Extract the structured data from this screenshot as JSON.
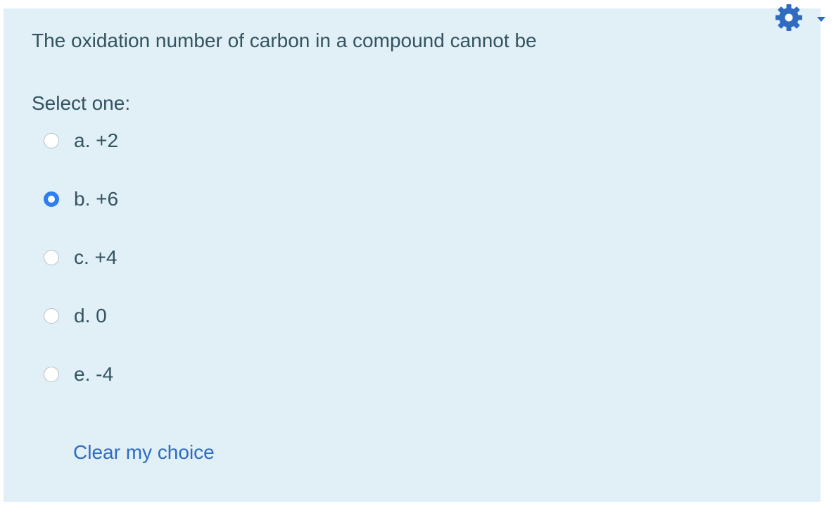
{
  "question": {
    "text": "The oxidation number of carbon in a compound cannot be",
    "prompt": "Select one:",
    "options": [
      {
        "label": "a. +2",
        "selected": false
      },
      {
        "label": "b. +6",
        "selected": true
      },
      {
        "label": "c. +4",
        "selected": false
      },
      {
        "label": "d. 0",
        "selected": false
      },
      {
        "label": "e. -4",
        "selected": false
      }
    ],
    "clear_label": "Clear my choice"
  },
  "toolbar": {
    "settings_icon": "gear-icon",
    "dropdown_icon": "caret-down-icon"
  },
  "colors": {
    "panel_background": "#e1eff7",
    "text": "#32535f",
    "link": "#2f6bbf",
    "accent": "#2f7ef0",
    "icon": "#2f6bbf"
  }
}
